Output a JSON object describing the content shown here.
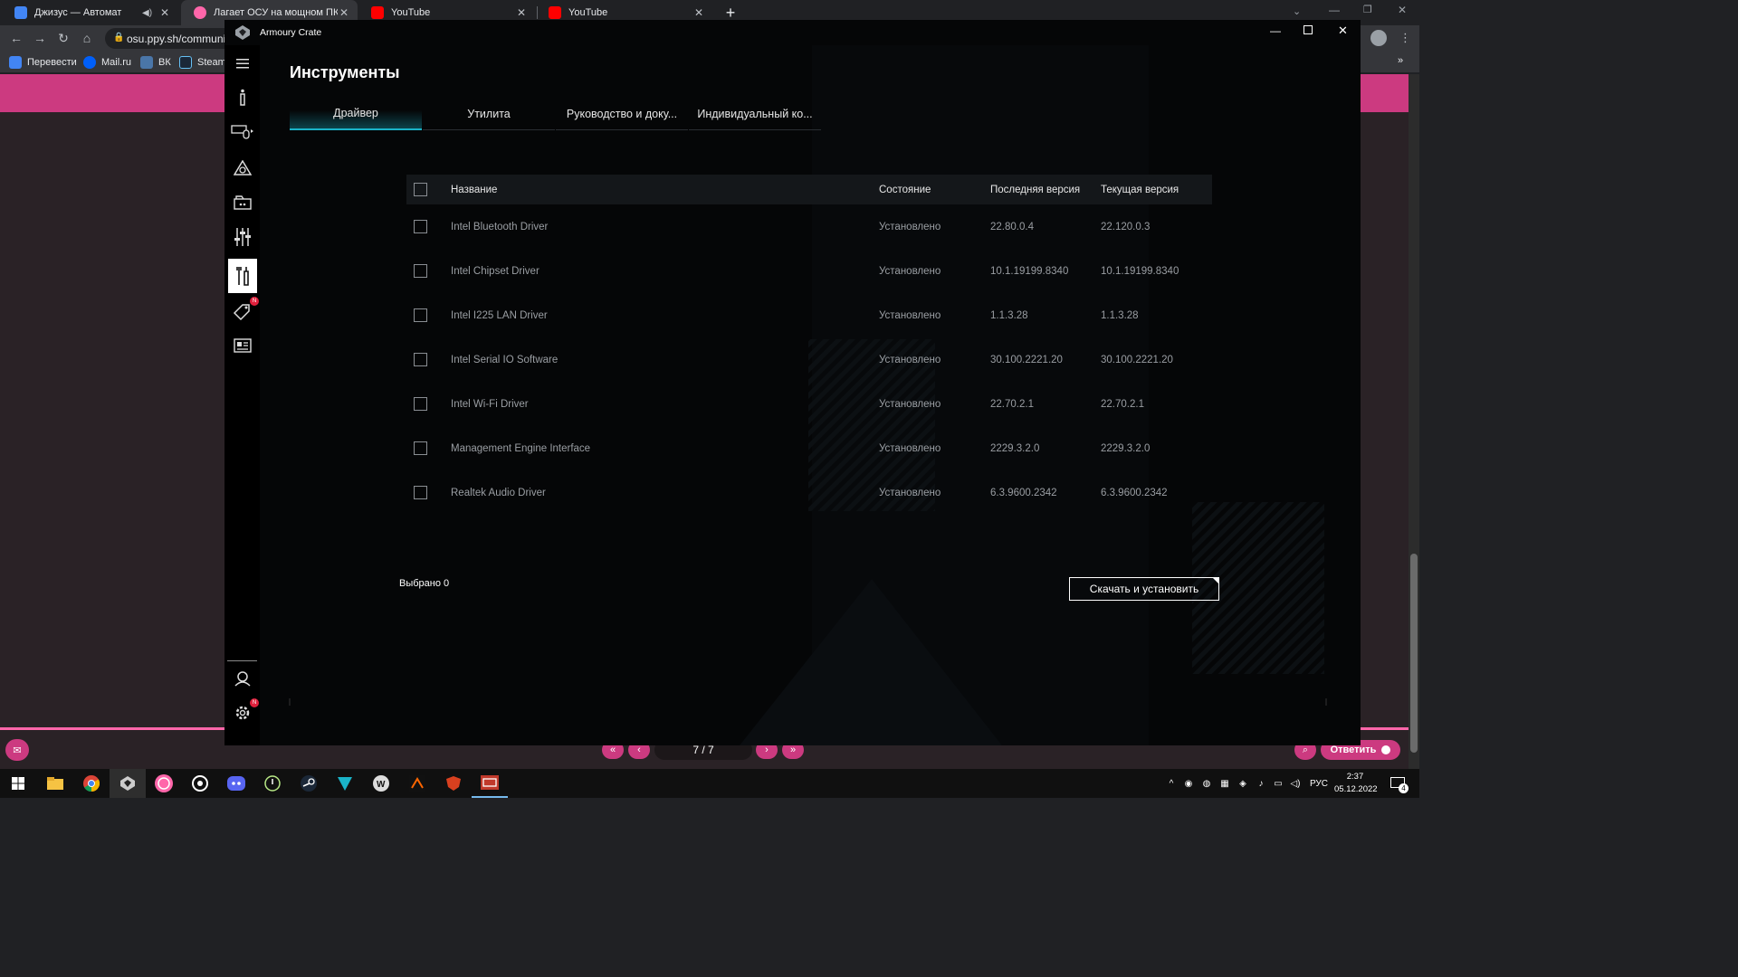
{
  "browser": {
    "tabs": [
      {
        "title": "Джизус — Автомат",
        "active": false,
        "color": "#4285f4"
      },
      {
        "title": "Лагает ОСУ на мощном ПК (ми",
        "active": true,
        "color": "#ff66aa"
      },
      {
        "title": "YouTube",
        "active": false,
        "color": "#ff0000"
      },
      {
        "title": "YouTube",
        "active": false,
        "color": "#ff0000"
      }
    ],
    "new_tab": "+",
    "url": "osu.ppy.sh/communi",
    "bookmarks": [
      {
        "label": "Перевести",
        "color": "#4285f4"
      },
      {
        "label": "Mail.ru",
        "color": "#005ff9"
      },
      {
        "label": "ВК",
        "color": "#4a76a8"
      },
      {
        "label": "Steam",
        "color": "#1b2838"
      }
    ]
  },
  "osu_page": {
    "pager": "7 / 7",
    "reply_label": "Ответить",
    "accent": "#cc3a80"
  },
  "app": {
    "title": "Armoury Crate",
    "heading": "Инструменты",
    "tabs": [
      "Драйвер",
      "Утилита",
      "Руководство и доку...",
      "Индивидуальный ко..."
    ],
    "sidebar_icons": [
      "info-icon",
      "keyboard-mouse-icon",
      "aura-icon",
      "game-library-icon",
      "mixer-icon",
      "tools-icon",
      "deals-icon",
      "news-icon",
      "user-icon",
      "settings-icon"
    ],
    "badge_new": "N",
    "table": {
      "headers": [
        "Название",
        "Состояние",
        "Последняя версия",
        "Текущая версия"
      ],
      "rows": [
        {
          "name": "Intel Bluetooth Driver",
          "status": "Установлено",
          "latest": "22.80.0.4",
          "current": "22.120.0.3"
        },
        {
          "name": "Intel Chipset Driver",
          "status": "Установлено",
          "latest": "10.1.19199.8340",
          "current": "10.1.19199.8340"
        },
        {
          "name": "Intel I225 LAN Driver",
          "status": "Установлено",
          "latest": "1.1.3.28",
          "current": "1.1.3.28"
        },
        {
          "name": "Intel Serial IO Software",
          "status": "Установлено",
          "latest": "30.100.2221.20",
          "current": "30.100.2221.20"
        },
        {
          "name": "Intel Wi-Fi Driver",
          "status": "Установлено",
          "latest": "22.70.2.1",
          "current": "22.70.2.1"
        },
        {
          "name": "Management Engine Interface",
          "status": "Установлено",
          "latest": "2229.3.2.0",
          "current": "2229.3.2.0"
        },
        {
          "name": "Realtek Audio Driver",
          "status": "Установлено",
          "latest": "6.3.9600.2342",
          "current": "6.3.9600.2342"
        }
      ]
    },
    "selected_label": "Выбрано 0",
    "download_button": "Скачать и установить",
    "accent": "#1ab3c8"
  },
  "taskbar": {
    "apps": [
      "windows-start-icon",
      "file-explorer-icon",
      "chrome-icon",
      "armoury-crate-icon",
      "osu-icon",
      "tool-icon",
      "discord-icon",
      "power-icon",
      "steam-icon",
      "vpn-icon",
      "wargaming-icon",
      "game-icon",
      "shield-game-icon",
      "game-launcher-icon"
    ],
    "lang": "РУС",
    "time": "2:37",
    "date": "05.12.2022",
    "notifications": "4"
  }
}
